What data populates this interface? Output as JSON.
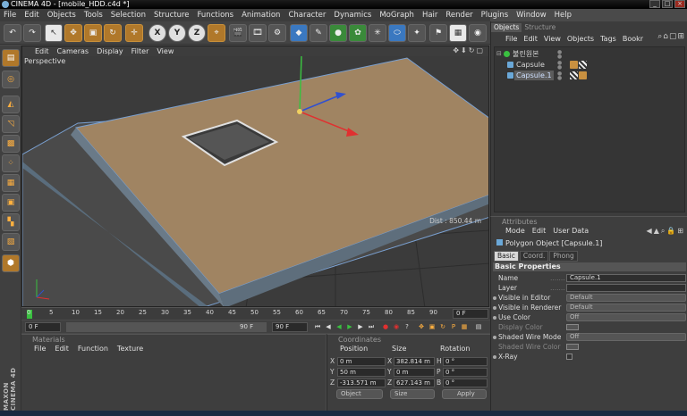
{
  "window": {
    "title": "CINEMA 4D - [mobile_HDD.c4d *]"
  },
  "menubar": [
    "File",
    "Edit",
    "Objects",
    "Tools",
    "Selection",
    "Structure",
    "Functions",
    "Animation",
    "Character",
    "Dynamics",
    "MoGraph",
    "Hair",
    "Render",
    "Plugins",
    "Window",
    "Help"
  ],
  "toolbar": {
    "axis_x": "X",
    "axis_y": "Y",
    "axis_z": "Z"
  },
  "viewport": {
    "menu": [
      "Edit",
      "Cameras",
      "Display",
      "Filter",
      "View"
    ],
    "label": "Perspective",
    "distance": "Dist : 850.44 m"
  },
  "timeline": {
    "ticks": [
      "0",
      "5",
      "10",
      "15",
      "20",
      "25",
      "30",
      "35",
      "40",
      "45",
      "50",
      "55",
      "60",
      "65",
      "70",
      "75",
      "80",
      "85",
      "90"
    ],
    "frame_end": "0 F",
    "current": "0 F",
    "range_end": "90 F",
    "max_frame": "90 F"
  },
  "materials": {
    "header": "Materials",
    "menu": [
      "File",
      "Edit",
      "Function",
      "Texture"
    ]
  },
  "coordinates": {
    "header": "Coordinates",
    "col_position": "Position",
    "col_size": "Size",
    "col_rotation": "Rotation",
    "rows": [
      {
        "axis": "X",
        "pos": "0 m",
        "size_axis": "X",
        "size": "382.814 m",
        "rot_axis": "H",
        "rot": "0 °"
      },
      {
        "axis": "Y",
        "pos": "50 m",
        "size_axis": "Y",
        "size": "0 m",
        "rot_axis": "P",
        "rot": "0 °"
      },
      {
        "axis": "Z",
        "pos": "-313.571 m",
        "size_axis": "Z",
        "size": "627.143 m",
        "rot_axis": "B",
        "rot": "0 °"
      }
    ],
    "mode_object": "Object",
    "mode_size": "Size",
    "apply": "Apply"
  },
  "objects_panel": {
    "tab_objects": "Objects",
    "tab_structure": "Structure",
    "menu": [
      "File",
      "Edit",
      "View",
      "Objects",
      "Tags",
      "Bookr"
    ],
    "items": [
      {
        "name": "불린원본"
      },
      {
        "name": "Capsule"
      },
      {
        "name": "Capsule.1"
      }
    ]
  },
  "attributes": {
    "header": "Attributes",
    "menu": [
      "Mode",
      "Edit",
      "User Data"
    ],
    "object_title": "Polygon Object [Capsule.1]",
    "tabs": [
      "Basic",
      "Coord.",
      "Phong"
    ],
    "section": "Basic Properties",
    "props": [
      {
        "label": "Name",
        "value": "Capsule.1"
      },
      {
        "label": "Layer",
        "value": ""
      },
      {
        "label": "Visible in Editor",
        "value": "Default"
      },
      {
        "label": "Visible in Renderer",
        "value": "Default"
      },
      {
        "label": "Use Color",
        "value": "Off"
      },
      {
        "label": "Display Color",
        "value": ""
      },
      {
        "label": "Shaded Wire Mode",
        "value": "Off"
      },
      {
        "label": "Shaded Wire Color",
        "value": ""
      },
      {
        "label": "X-Ray",
        "value": ""
      }
    ]
  }
}
